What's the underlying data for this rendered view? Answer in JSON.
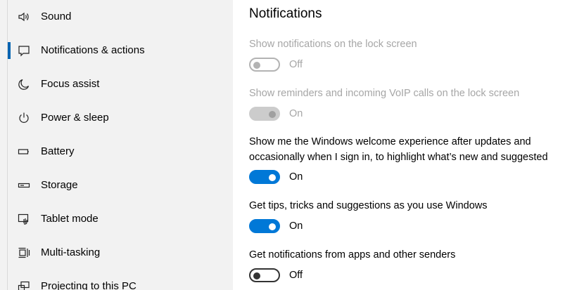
{
  "sidebar": {
    "items": [
      {
        "label": "Sound",
        "icon": "speaker-icon",
        "selected": false
      },
      {
        "label": "Notifications & actions",
        "icon": "notification-icon",
        "selected": true
      },
      {
        "label": "Focus assist",
        "icon": "moon-icon",
        "selected": false
      },
      {
        "label": "Power & sleep",
        "icon": "power-icon",
        "selected": false
      },
      {
        "label": "Battery",
        "icon": "battery-icon",
        "selected": false
      },
      {
        "label": "Storage",
        "icon": "storage-icon",
        "selected": false
      },
      {
        "label": "Tablet mode",
        "icon": "tablet-mode-icon",
        "selected": false
      },
      {
        "label": "Multi-tasking",
        "icon": "multitasking-icon",
        "selected": false
      },
      {
        "label": "Projecting to this PC",
        "icon": "projecting-icon",
        "selected": false
      }
    ]
  },
  "content": {
    "title": "Notifications",
    "settings": [
      {
        "label": "Show notifications on the lock screen",
        "state": "Off",
        "on": false,
        "disabled": true
      },
      {
        "label": "Show reminders and incoming VoIP calls on the lock screen",
        "state": "On",
        "on": true,
        "disabled": true
      },
      {
        "label": "Show me the Windows welcome experience after updates and occasionally when I sign in, to highlight what’s new and suggested",
        "state": "On",
        "on": true,
        "disabled": false
      },
      {
        "label": "Get tips, tricks and suggestions as you use Windows",
        "state": "On",
        "on": true,
        "disabled": false
      },
      {
        "label": "Get notifications from apps and other senders",
        "state": "Off",
        "on": false,
        "disabled": false
      }
    ]
  },
  "colors": {
    "accent": "#0078d7",
    "sidebar_bg": "#f2f2f2",
    "disabled_text": "#a6a6a6"
  }
}
